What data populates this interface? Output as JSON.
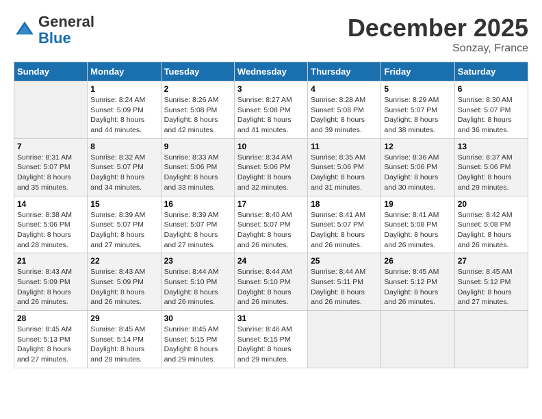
{
  "header": {
    "logo_general": "General",
    "logo_blue": "Blue",
    "month_title": "December 2025",
    "location": "Sonzay, France"
  },
  "columns": [
    "Sunday",
    "Monday",
    "Tuesday",
    "Wednesday",
    "Thursday",
    "Friday",
    "Saturday"
  ],
  "weeks": [
    [
      {
        "day": "",
        "sunrise": "",
        "sunset": "",
        "daylight": ""
      },
      {
        "day": "1",
        "sunrise": "Sunrise: 8:24 AM",
        "sunset": "Sunset: 5:09 PM",
        "daylight": "Daylight: 8 hours and 44 minutes."
      },
      {
        "day": "2",
        "sunrise": "Sunrise: 8:26 AM",
        "sunset": "Sunset: 5:08 PM",
        "daylight": "Daylight: 8 hours and 42 minutes."
      },
      {
        "day": "3",
        "sunrise": "Sunrise: 8:27 AM",
        "sunset": "Sunset: 5:08 PM",
        "daylight": "Daylight: 8 hours and 41 minutes."
      },
      {
        "day": "4",
        "sunrise": "Sunrise: 8:28 AM",
        "sunset": "Sunset: 5:08 PM",
        "daylight": "Daylight: 8 hours and 39 minutes."
      },
      {
        "day": "5",
        "sunrise": "Sunrise: 8:29 AM",
        "sunset": "Sunset: 5:07 PM",
        "daylight": "Daylight: 8 hours and 38 minutes."
      },
      {
        "day": "6",
        "sunrise": "Sunrise: 8:30 AM",
        "sunset": "Sunset: 5:07 PM",
        "daylight": "Daylight: 8 hours and 36 minutes."
      }
    ],
    [
      {
        "day": "7",
        "sunrise": "Sunrise: 8:31 AM",
        "sunset": "Sunset: 5:07 PM",
        "daylight": "Daylight: 8 hours and 35 minutes."
      },
      {
        "day": "8",
        "sunrise": "Sunrise: 8:32 AM",
        "sunset": "Sunset: 5:07 PM",
        "daylight": "Daylight: 8 hours and 34 minutes."
      },
      {
        "day": "9",
        "sunrise": "Sunrise: 8:33 AM",
        "sunset": "Sunset: 5:06 PM",
        "daylight": "Daylight: 8 hours and 33 minutes."
      },
      {
        "day": "10",
        "sunrise": "Sunrise: 8:34 AM",
        "sunset": "Sunset: 5:06 PM",
        "daylight": "Daylight: 8 hours and 32 minutes."
      },
      {
        "day": "11",
        "sunrise": "Sunrise: 8:35 AM",
        "sunset": "Sunset: 5:06 PM",
        "daylight": "Daylight: 8 hours and 31 minutes."
      },
      {
        "day": "12",
        "sunrise": "Sunrise: 8:36 AM",
        "sunset": "Sunset: 5:06 PM",
        "daylight": "Daylight: 8 hours and 30 minutes."
      },
      {
        "day": "13",
        "sunrise": "Sunrise: 8:37 AM",
        "sunset": "Sunset: 5:06 PM",
        "daylight": "Daylight: 8 hours and 29 minutes."
      }
    ],
    [
      {
        "day": "14",
        "sunrise": "Sunrise: 8:38 AM",
        "sunset": "Sunset: 5:06 PM",
        "daylight": "Daylight: 8 hours and 28 minutes."
      },
      {
        "day": "15",
        "sunrise": "Sunrise: 8:39 AM",
        "sunset": "Sunset: 5:07 PM",
        "daylight": "Daylight: 8 hours and 27 minutes."
      },
      {
        "day": "16",
        "sunrise": "Sunrise: 8:39 AM",
        "sunset": "Sunset: 5:07 PM",
        "daylight": "Daylight: 8 hours and 27 minutes."
      },
      {
        "day": "17",
        "sunrise": "Sunrise: 8:40 AM",
        "sunset": "Sunset: 5:07 PM",
        "daylight": "Daylight: 8 hours and 26 minutes."
      },
      {
        "day": "18",
        "sunrise": "Sunrise: 8:41 AM",
        "sunset": "Sunset: 5:07 PM",
        "daylight": "Daylight: 8 hours and 26 minutes."
      },
      {
        "day": "19",
        "sunrise": "Sunrise: 8:41 AM",
        "sunset": "Sunset: 5:08 PM",
        "daylight": "Daylight: 8 hours and 26 minutes."
      },
      {
        "day": "20",
        "sunrise": "Sunrise: 8:42 AM",
        "sunset": "Sunset: 5:08 PM",
        "daylight": "Daylight: 8 hours and 26 minutes."
      }
    ],
    [
      {
        "day": "21",
        "sunrise": "Sunrise: 8:43 AM",
        "sunset": "Sunset: 5:09 PM",
        "daylight": "Daylight: 8 hours and 26 minutes."
      },
      {
        "day": "22",
        "sunrise": "Sunrise: 8:43 AM",
        "sunset": "Sunset: 5:09 PM",
        "daylight": "Daylight: 8 hours and 26 minutes."
      },
      {
        "day": "23",
        "sunrise": "Sunrise: 8:44 AM",
        "sunset": "Sunset: 5:10 PM",
        "daylight": "Daylight: 8 hours and 26 minutes."
      },
      {
        "day": "24",
        "sunrise": "Sunrise: 8:44 AM",
        "sunset": "Sunset: 5:10 PM",
        "daylight": "Daylight: 8 hours and 26 minutes."
      },
      {
        "day": "25",
        "sunrise": "Sunrise: 8:44 AM",
        "sunset": "Sunset: 5:11 PM",
        "daylight": "Daylight: 8 hours and 26 minutes."
      },
      {
        "day": "26",
        "sunrise": "Sunrise: 8:45 AM",
        "sunset": "Sunset: 5:12 PM",
        "daylight": "Daylight: 8 hours and 26 minutes."
      },
      {
        "day": "27",
        "sunrise": "Sunrise: 8:45 AM",
        "sunset": "Sunset: 5:12 PM",
        "daylight": "Daylight: 8 hours and 27 minutes."
      }
    ],
    [
      {
        "day": "28",
        "sunrise": "Sunrise: 8:45 AM",
        "sunset": "Sunset: 5:13 PM",
        "daylight": "Daylight: 8 hours and 27 minutes."
      },
      {
        "day": "29",
        "sunrise": "Sunrise: 8:45 AM",
        "sunset": "Sunset: 5:14 PM",
        "daylight": "Daylight: 8 hours and 28 minutes."
      },
      {
        "day": "30",
        "sunrise": "Sunrise: 8:45 AM",
        "sunset": "Sunset: 5:15 PM",
        "daylight": "Daylight: 8 hours and 29 minutes."
      },
      {
        "day": "31",
        "sunrise": "Sunrise: 8:46 AM",
        "sunset": "Sunset: 5:15 PM",
        "daylight": "Daylight: 8 hours and 29 minutes."
      },
      {
        "day": "",
        "sunrise": "",
        "sunset": "",
        "daylight": ""
      },
      {
        "day": "",
        "sunrise": "",
        "sunset": "",
        "daylight": ""
      },
      {
        "day": "",
        "sunrise": "",
        "sunset": "",
        "daylight": ""
      }
    ]
  ]
}
